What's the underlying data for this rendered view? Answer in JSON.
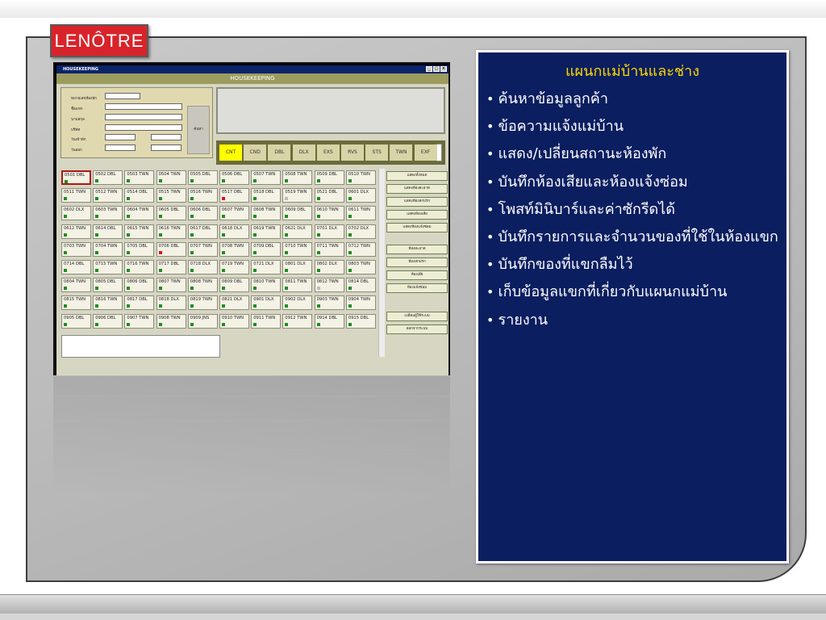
{
  "logo": {
    "text": "LENÔTRE"
  },
  "app": {
    "window_title": "HOUSEKEEPING",
    "header": "HOUSEKEEPING",
    "form": {
      "fields": [
        {
          "label": "หมายเลขห้องพัก"
        },
        {
          "label": "ชื่อแขก"
        },
        {
          "label": "นามสกุล"
        },
        {
          "label": "บริษัท"
        },
        {
          "label": "วันเข้าพัก"
        },
        {
          "label": "วันออก"
        }
      ],
      "search_label": "ค้นหา"
    },
    "filters": [
      "CNT",
      "CND",
      "DBL",
      "DLX",
      "EXS",
      "RVS",
      "STS",
      "TWN",
      "EXF"
    ],
    "active_filter": "CNT",
    "rooms": [
      [
        "0501 DBL",
        "0502 DBL",
        "0503 TWN",
        "0504 TWN",
        "0505 DBL",
        "0506 DBL",
        "0507 TWN",
        "0508 TWN",
        "0509 DBL",
        "0510 TWN"
      ],
      [
        "0511 TWN",
        "0512 TWN",
        "0514 DBL",
        "0515 TWN",
        "0516 TWN",
        "0517 DBL",
        "0518 DBL",
        "0519 TWN",
        "0521 DBL",
        "0601 DLX"
      ],
      [
        "0602 DLX",
        "0603 TWN",
        "0604 TWN",
        "0605 DBL",
        "0606 DBL",
        "0607 TWN",
        "0608 TWN",
        "0609 DBL",
        "0610 TWN",
        "0611 TWN"
      ],
      [
        "0612 TWN",
        "0614 DBL",
        "0615 TWN",
        "0616 TWN",
        "0617 DBL",
        "0618 DLX",
        "0619 TWN",
        "0621 DLX",
        "0701 DLX",
        "0702 DLX"
      ],
      [
        "0703 TWN",
        "0704 TWN",
        "0705 DBL",
        "0706 DBL",
        "0707 TWN",
        "0708 TWN",
        "0709 DBL",
        "0710 TWN",
        "0711 TWN",
        "0712 TWN"
      ],
      [
        "0714 DBL",
        "0715 TWN",
        "0716 TWN",
        "0717 DBL",
        "0718 DLX",
        "0719 TWN",
        "0721 DLX",
        "0801 DLX",
        "0802 DLX",
        "0803 TWN"
      ],
      [
        "0804 TWN",
        "0805 DBL",
        "0806 DBL",
        "0807 TWN",
        "0808 TWN",
        "0809 DBL",
        "0810 TWN",
        "0811 TWN",
        "0812 TWN",
        "0814 DBL"
      ],
      [
        "0815 TWN",
        "0816 TWN",
        "0817 DBL",
        "0818 DLX",
        "0819 TWN",
        "0821 DLX",
        "0901 DLX",
        "0902 DLX",
        "0903 TWN",
        "0904 TWN"
      ],
      [
        "0905 DBL",
        "0906 DBL",
        "0907 TWN",
        "0908 TWN",
        "0909 JNS",
        "0910 TWN",
        "0911 TWN",
        "0912 TWN",
        "0914 DBL",
        "0915 DBL"
      ]
    ],
    "room_status_colors": {
      "normal": "#1f8f1f",
      "alert": "#e01010",
      "inactive": "#bcbcbc"
    },
    "side_buttons_group1": [
      "แสดงทั้งหมด",
      "แสดงห้องสะอาด",
      "แสดงห้องสกปรก",
      "แสดงห้องเสีย",
      "แสดงห้องแจ้งซ่อม"
    ],
    "side_buttons_group2": [
      "ห้องสะอาด",
      "ห้องสกปรก",
      "ห้องเสีย",
      "ห้องแจ้งซ่อม"
    ],
    "side_buttons_group3": [
      "เปลี่ยนผู้ใช้ระบบ",
      "ออกจากระบบ"
    ]
  },
  "panel": {
    "title": "แผนกแม่บ้านและช่าง",
    "items": [
      "ค้นหาข้อมูลลูกค้า",
      "ข้อความแจ้งแม่บ้าน",
      "แสดง/เปลี่ยนสถานะห้องพัก",
      "บันทึกห้องเสียและห้องแจ้งซ่อม",
      "โพสท์มินิบาร์และค่าซักรีดได้",
      "บันทึกรายการและจำนวนของที่ใช้ในห้องแขก",
      "บันทึกของที่แขกลืมไว้",
      "เก็บข้อมูลแขกที่เกี่ยวกับแผนกแม่บ้าน",
      "รายงาน"
    ],
    "title_color": "#ffd700",
    "bg_color": "#0b1e60"
  }
}
